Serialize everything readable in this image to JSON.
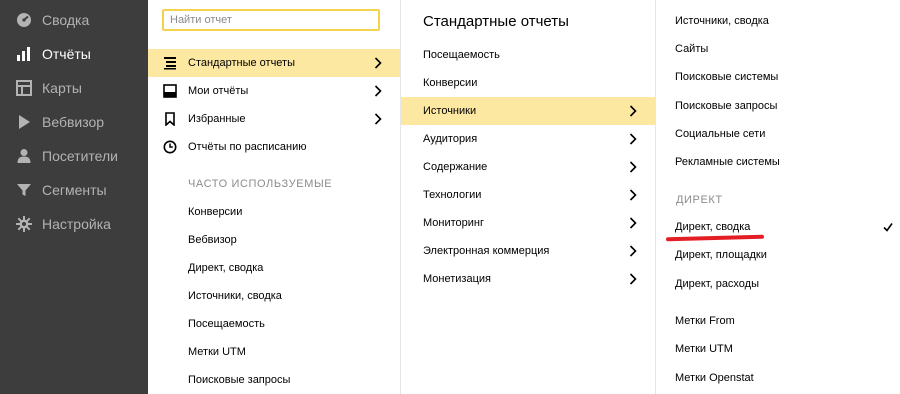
{
  "sidebar": {
    "items": [
      {
        "label": "Сводка",
        "icon": "dashboard-icon",
        "active": false
      },
      {
        "label": "Отчёты",
        "icon": "bar-chart-icon",
        "active": true
      },
      {
        "label": "Карты",
        "icon": "map-icon",
        "active": false
      },
      {
        "label": "Вебвизор",
        "icon": "play-icon",
        "active": false
      },
      {
        "label": "Посетители",
        "icon": "person-icon",
        "active": false
      },
      {
        "label": "Сегменты",
        "icon": "funnel-icon",
        "active": false
      },
      {
        "label": "Настройка",
        "icon": "gear-icon",
        "active": false
      }
    ]
  },
  "reports_menu": {
    "search": {
      "placeholder": "Найти отчет",
      "value": ""
    },
    "items": [
      {
        "label": "Стандартные отчеты",
        "icon": "list-icon",
        "highlighted": true,
        "has_submenu": true
      },
      {
        "label": "Мои отчёты",
        "icon": "inbox-icon",
        "highlighted": false,
        "has_submenu": true
      },
      {
        "label": "Избранные",
        "icon": "bookmark-icon",
        "highlighted": false,
        "has_submenu": true
      },
      {
        "label": "Отчёты по расписанию",
        "icon": "clock-icon",
        "highlighted": false,
        "has_submenu": false
      }
    ],
    "frequent_heading": "ЧАСТО ИСПОЛЬЗУЕМЫЕ",
    "frequent": [
      "Конверсии",
      "Вебвизор",
      "Директ, сводка",
      "Источники, сводка",
      "Посещаемость",
      "Метки UTM",
      "Поисковые запросы"
    ]
  },
  "standard_reports": {
    "title": "Стандартные отчеты",
    "items": [
      {
        "label": "Посещаемость",
        "highlighted": false,
        "has_submenu": false
      },
      {
        "label": "Конверсии",
        "highlighted": false,
        "has_submenu": false
      },
      {
        "label": "Источники",
        "highlighted": true,
        "has_submenu": true
      },
      {
        "label": "Аудитория",
        "highlighted": false,
        "has_submenu": true
      },
      {
        "label": "Содержание",
        "highlighted": false,
        "has_submenu": true
      },
      {
        "label": "Технологии",
        "highlighted": false,
        "has_submenu": true
      },
      {
        "label": "Мониторинг",
        "highlighted": false,
        "has_submenu": true
      },
      {
        "label": "Электронная коммерция",
        "highlighted": false,
        "has_submenu": true
      },
      {
        "label": "Монетизация",
        "highlighted": false,
        "has_submenu": true
      }
    ]
  },
  "sources": {
    "items": [
      "Источники, сводка",
      "Сайты",
      "Поисковые системы",
      "Поисковые запросы",
      "Социальные сети",
      "Рекламные системы"
    ],
    "direct_heading": "ДИРЕКТ",
    "direct_items": [
      {
        "label": "Директ, сводка",
        "checked": true
      },
      {
        "label": "Директ, площадки",
        "checked": false
      },
      {
        "label": "Директ, расходы",
        "checked": false
      }
    ],
    "tags": [
      "Метки From",
      "Метки UTM",
      "Метки Openstat"
    ]
  },
  "colors": {
    "sidebar_bg": "#3d3d3d",
    "highlight": "#fde8a2",
    "search_border": "#f5d24b",
    "annotation_red": "#e21d24"
  }
}
